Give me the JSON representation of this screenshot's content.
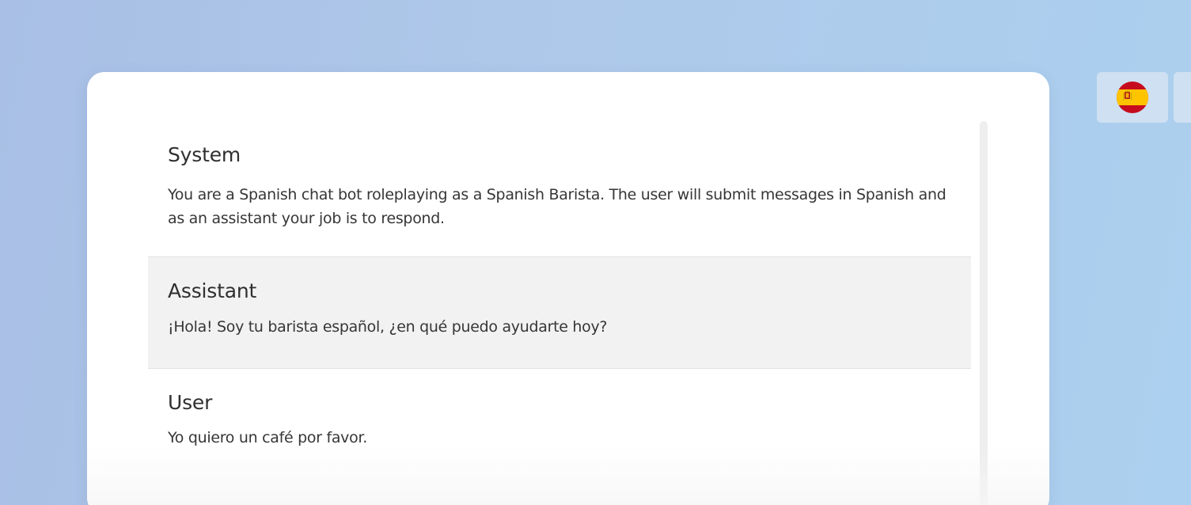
{
  "conversation": {
    "messages": [
      {
        "role": "System",
        "text": "You are a Spanish chat bot roleplaying as a Spanish Barista. The user will submit messages in Spanish and as an assistant your job is to respond."
      },
      {
        "role": "Assistant",
        "text": "¡Hola! Soy tu barista español, ¿en qué puedo ayudarte hoy?"
      },
      {
        "role": "User",
        "text": "Yo quiero un café por favor."
      }
    ]
  },
  "language_selector": {
    "selected_icon": "spain-flag-icon",
    "colors": {
      "red": "#c60b1e",
      "yellow": "#ffc400"
    }
  },
  "colors": {
    "background_gradient": [
      "#a9bfe5",
      "#acd0ef"
    ],
    "card": "#ffffff",
    "highlight_row": "#f2f2f2",
    "text": "#333333"
  }
}
